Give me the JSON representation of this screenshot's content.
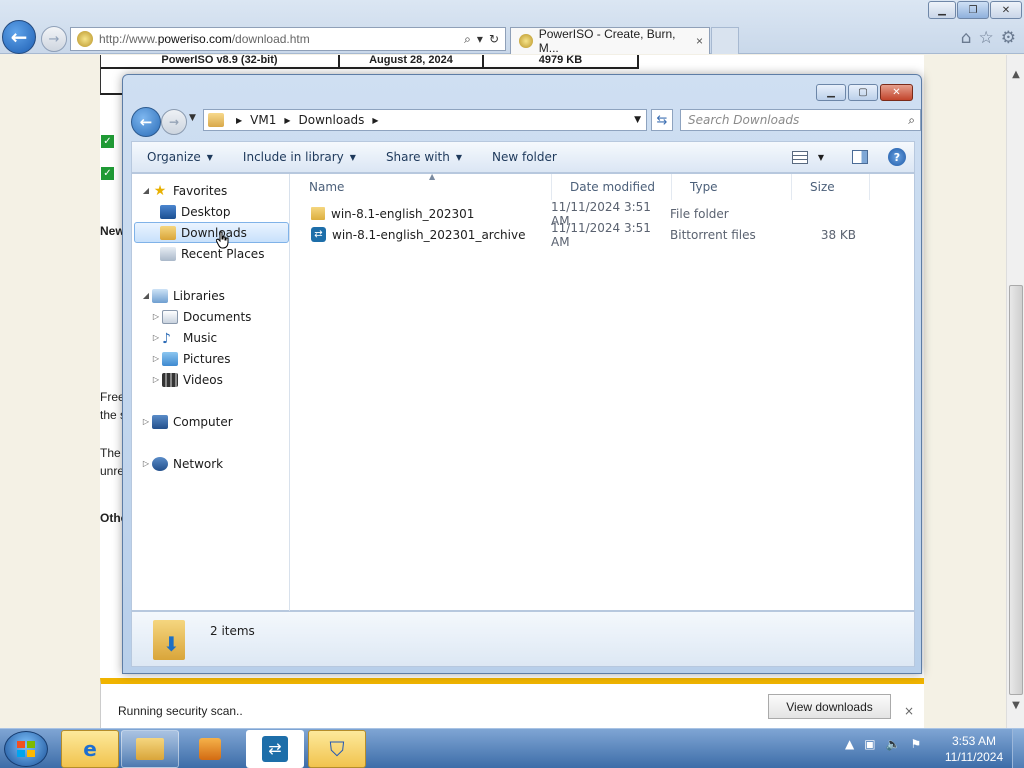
{
  "ie": {
    "url_prefix": "http://www.",
    "url_domain": "poweriso.com",
    "url_path": "/download.htm",
    "tab_title": "PowerISO - Create, Burn, M...",
    "tab_close": "×"
  },
  "page": {
    "table_row": [
      "PowerISO v8.9 (32-bit)",
      "August 28, 2024",
      "4979 KB"
    ],
    "frag_new": "New",
    "frag_free": "Free",
    "frag_the_s": "the s",
    "frag_the": "The",
    "frag_unre": "unre",
    "frag_other": "Othe"
  },
  "download_bar": {
    "message": "Running security scan..",
    "view_button": "View downloads",
    "close": "×"
  },
  "explorer": {
    "breadcrumb": [
      "VM1",
      "Downloads"
    ],
    "search_placeholder": "Search Downloads",
    "toolbar": {
      "organize": "Organize",
      "include_in_library": "Include in library",
      "share_with": "Share with",
      "new_folder": "New folder"
    },
    "nav": {
      "favorites": "Favorites",
      "desktop": "Desktop",
      "downloads": "Downloads",
      "recent_places": "Recent Places",
      "libraries": "Libraries",
      "documents": "Documents",
      "music": "Music",
      "pictures": "Pictures",
      "videos": "Videos",
      "computer": "Computer",
      "network": "Network"
    },
    "columns": [
      "Name",
      "Date modified",
      "Type",
      "Size"
    ],
    "files": [
      {
        "name": "win-8.1-english_202301",
        "date": "11/11/2024 3:51 AM",
        "type": "File folder",
        "size": "",
        "icon": "folder-icon"
      },
      {
        "name": "win-8.1-english_202301_archive",
        "date": "11/11/2024 3:51 AM",
        "type": "Bittorrent files",
        "size": "38 KB",
        "icon": "torrent-icon"
      }
    ],
    "status": "2 items"
  },
  "taskbar": {
    "time": "3:53 AM",
    "date": "11/11/2024"
  }
}
